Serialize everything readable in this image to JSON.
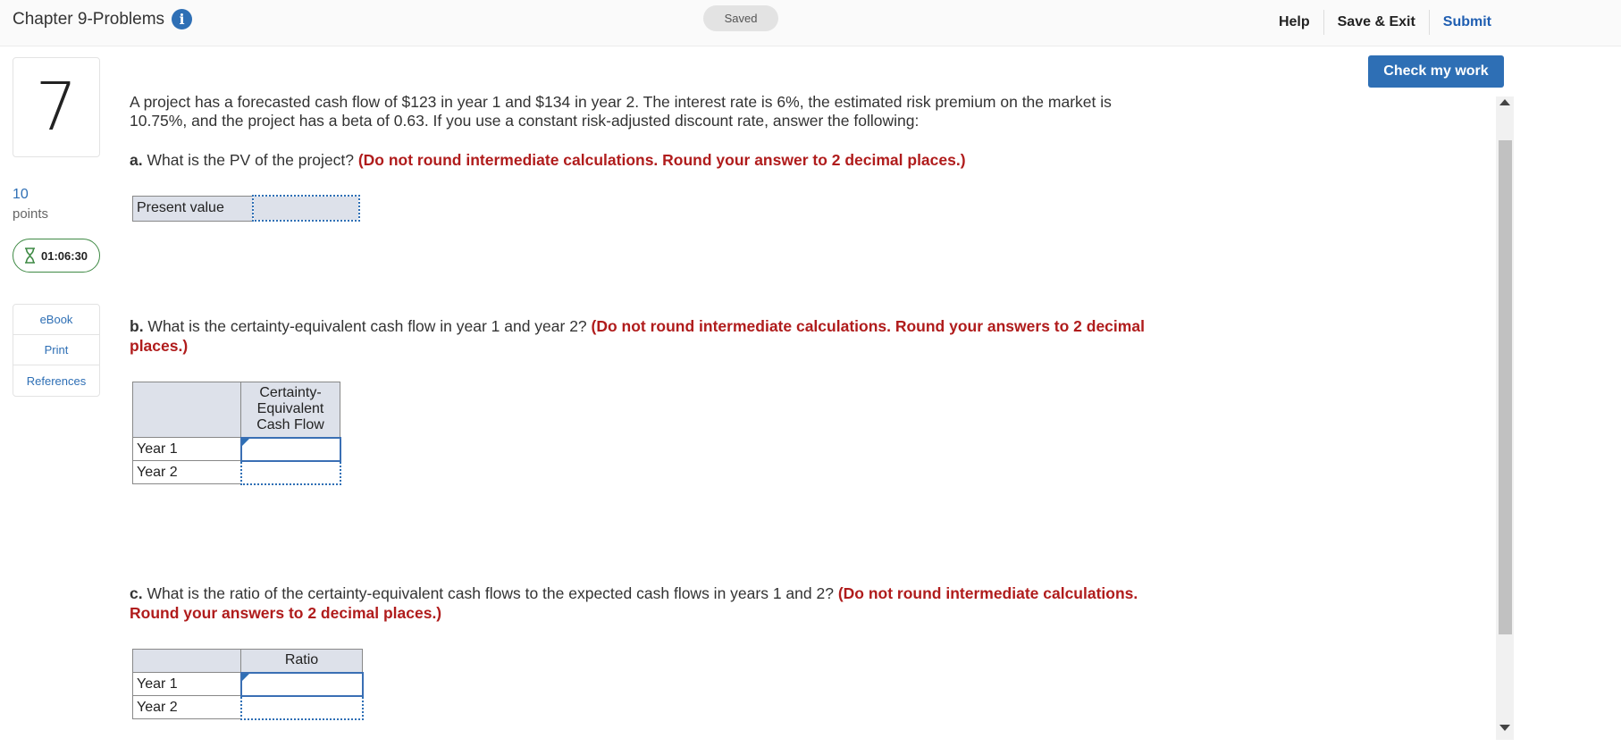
{
  "header": {
    "chapter_title": "Chapter 9-Problems",
    "saved_label": "Saved",
    "help_label": "Help",
    "save_exit_label": "Save & Exit",
    "submit_label": "Submit"
  },
  "sidebar": {
    "question_number": "7",
    "points_value": "10",
    "points_label": "points",
    "timer": "01:06:30",
    "links": [
      {
        "label": "eBook"
      },
      {
        "label": "Print"
      },
      {
        "label": "References"
      }
    ]
  },
  "check_button": "Check my work",
  "question": {
    "intro": "A project has a forecasted cash flow of $123 in year 1 and $134 in year 2. The interest rate is 6%, the estimated risk premium on the market is 10.75%, and the project has a beta of 0.63. If you use a constant risk-adjusted discount rate, answer the following:",
    "part_a": {
      "label": "a.",
      "text": " What is the PV of the project? ",
      "instruction": "(Do not round intermediate calculations. Round your answer to 2 decimal places.)",
      "row_label": "Present value"
    },
    "part_b": {
      "label": "b.",
      "text": " What is the certainty-equivalent cash flow in year 1 and year 2? ",
      "instruction": "(Do not round intermediate calculations. Round your answers to 2 decimal places.)",
      "column_header": "Certainty-Equivalent Cash Flow",
      "rows": [
        "Year 1",
        "Year 2"
      ]
    },
    "part_c": {
      "label": "c.",
      "text": " What is the ratio of the certainty-equivalent cash flows to the expected cash flows in years 1 and 2? ",
      "instruction": "(Do not round intermediate calculations. Round your answers to 2 decimal places.)",
      "column_header": "Ratio",
      "rows": [
        "Year 1",
        "Year 2"
      ]
    }
  }
}
